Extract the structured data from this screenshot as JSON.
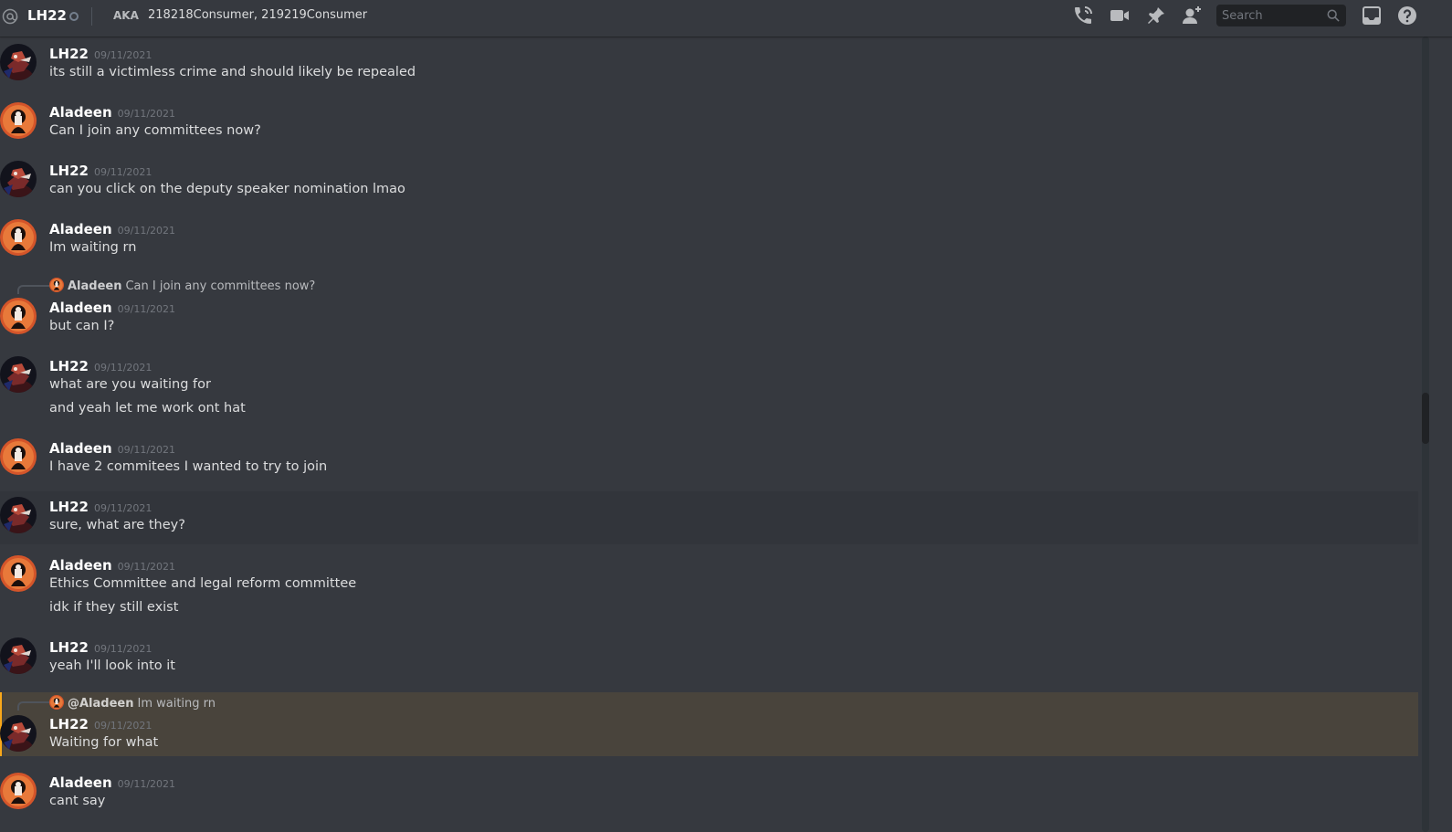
{
  "header": {
    "channel_name": "LH22",
    "aka_label": "AKA",
    "aka_value": "218218Consumer, 219219Consumer",
    "search_placeholder": "Search",
    "icons": [
      "at-icon",
      "call-icon",
      "video-icon",
      "pin-icon",
      "add-friend-icon",
      "search-icon",
      "inbox-icon",
      "help-icon"
    ]
  },
  "colors": {
    "background": "#36393f",
    "header_text": "#ffffff",
    "message_text": "#dcddde",
    "timestamp": "#72767d",
    "mention_highlight": "#49443c",
    "mention_bar": "#faa81a"
  },
  "messages": [
    {
      "author": "LH22",
      "timestamp": "09/11/2021",
      "lines": [
        "its still a victimless crime and should likely be repealed"
      ]
    },
    {
      "author": "Aladeen",
      "timestamp": "09/11/2021",
      "lines": [
        "Can I join any committees now?"
      ]
    },
    {
      "author": "LH22",
      "timestamp": "09/11/2021",
      "lines": [
        "can you click on the deputy speaker nomination lmao"
      ]
    },
    {
      "author": "Aladeen",
      "timestamp": "09/11/2021",
      "lines": [
        "Im waiting rn"
      ]
    },
    {
      "author": "Aladeen",
      "timestamp": "09/11/2021",
      "reply": {
        "author": "Aladeen",
        "text": "Can I join any committees now?"
      },
      "lines": [
        "but can I?"
      ]
    },
    {
      "author": "LH22",
      "timestamp": "09/11/2021",
      "lines": [
        "what are you waiting for",
        "and yeah let me work ont hat"
      ]
    },
    {
      "author": "Aladeen",
      "timestamp": "09/11/2021",
      "lines": [
        "I have 2 commitees I wanted to try to join"
      ]
    },
    {
      "author": "LH22",
      "timestamp": "09/11/2021",
      "lines": [
        "sure, what are they?"
      ]
    },
    {
      "author": "Aladeen",
      "timestamp": "09/11/2021",
      "lines": [
        "Ethics Committee and legal reform committee",
        "idk if they still exist"
      ]
    },
    {
      "author": "LH22",
      "timestamp": "09/11/2021",
      "lines": [
        "yeah I'll look into it"
      ]
    },
    {
      "author": "LH22",
      "timestamp": "09/11/2021",
      "reply": {
        "author": "@Aladeen",
        "text": "Im waiting rn"
      },
      "lines": [
        "Waiting for what"
      ]
    },
    {
      "author": "Aladeen",
      "timestamp": "09/11/2021",
      "lines": [
        "cant say"
      ]
    }
  ]
}
